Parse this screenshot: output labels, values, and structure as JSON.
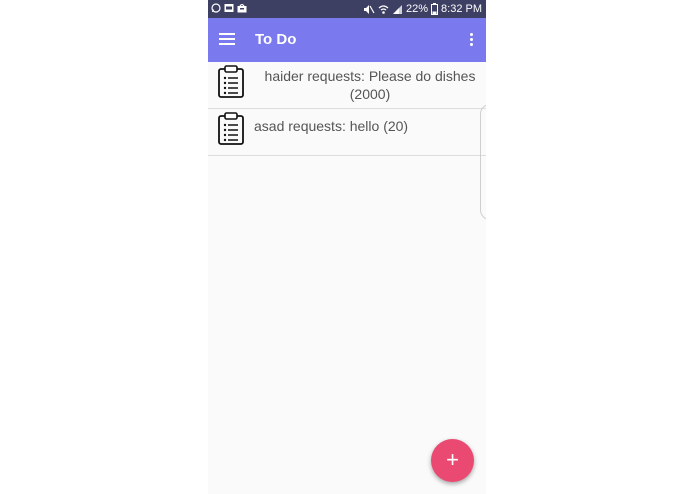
{
  "status_bar": {
    "battery": "22%",
    "time": "8:32 PM",
    "icons": [
      "whatsapp-icon",
      "message-icon",
      "bag-icon",
      "mute-icon",
      "wifi-icon",
      "signal-icon",
      "battery-icon"
    ]
  },
  "app_bar": {
    "title": "To Do",
    "menu_icon": "hamburger-icon",
    "overflow_icon": "overflow-menu-icon",
    "color": "#7b79ee"
  },
  "list": {
    "items": [
      {
        "line1": "haider requests: Please do dishes",
        "line2": "(2000)",
        "icon": "clipboard-icon"
      },
      {
        "line1": "asad requests: hello (20)",
        "icon": "clipboard-icon"
      }
    ]
  },
  "fab": {
    "label": "+",
    "color": "#ea4a72"
  }
}
